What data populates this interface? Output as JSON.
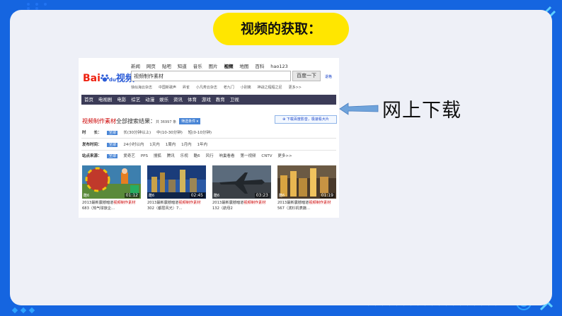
{
  "slide": {
    "title": "视频的获取：",
    "download_label": "网上下载",
    "accent_yellow": "#ffe600",
    "background_blue": "#1565e0"
  },
  "baidu": {
    "logo_bai": "Bai",
    "logo_du": "du",
    "logo_video": "视频",
    "topnav": [
      "新闻",
      "网页",
      "贴吧",
      "知道",
      "音乐",
      "图片",
      "视频",
      "地图",
      "百科",
      "hao123"
    ],
    "active_nav": "视频",
    "search_value": "视频制作素材",
    "search_button": "百度一下",
    "advanced_link": "退格",
    "hotwords": [
      "徐似海云杂志",
      "中国新歌声",
      "昇雀",
      "小凡寿云杂志",
      "老九门",
      "小别离",
      "神战之程程之尼",
      "更多>>"
    ],
    "categories": [
      "首页",
      "电视剧",
      "电影",
      "综艺",
      "动漫",
      "娱乐",
      "资讯",
      "体育",
      "游戏",
      "教育",
      "卫视"
    ],
    "results_query": "视频制作素材",
    "results_suffix": "全部搜索结果：",
    "results_count": "共 36997 条",
    "filter_button": "筛选条件 ▾",
    "hd_button": "下载百度影音，极速看大片",
    "filters": [
      {
        "label": "时　　长：",
        "options": [
          "全部",
          "长(30分钟以上)",
          "中(10-30分钟)",
          "短(0-10分钟)"
        ]
      },
      {
        "label": "发布时间：",
        "options": [
          "全部",
          "24小时以内",
          "1天内",
          "1周内",
          "1月内",
          "1年内"
        ]
      },
      {
        "label": "站点来源：",
        "options": [
          "全部",
          "爱奇艺",
          "PPS",
          "搜狐",
          "腾讯",
          "乐视",
          "酷6",
          "风行",
          "响巢看看",
          "第一视频",
          "CNTV",
          "更多>>"
        ]
      }
    ],
    "videos": [
      {
        "source": "酷6",
        "duration": "01:12",
        "cap1": "2013最新震撼暗道",
        "cap_hl": "视频制作素材",
        "cap2": "683（热气球旅企..."
      },
      {
        "source": "酷6",
        "duration": "02:45",
        "cap1": "2013最新震撼暗道",
        "cap_hl": "视频制作素材",
        "cap2": "302（都层风光）7..."
      },
      {
        "source": "酷6",
        "duration": "03:23",
        "cap1": "2013最新震撼暗道",
        "cap_hl": "视频制作素材",
        "cap2": "132（航母2"
      },
      {
        "source": "酷6",
        "duration": "01:19",
        "cap1": "2013最新震撼暗道",
        "cap_hl": "视频制作素材",
        "cap2": "567（滨杉机表撒..."
      }
    ]
  }
}
